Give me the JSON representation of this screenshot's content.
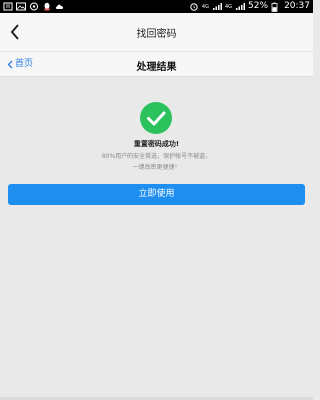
{
  "status_bar": {
    "net_label": "4G",
    "battery": "52%",
    "time": "20:37"
  },
  "header": {
    "title": "找回密码"
  },
  "subnav": {
    "home_label": "首页",
    "title": "处理结果"
  },
  "result": {
    "title": "重置密码成功!",
    "desc1": "80%用户的安全首选，保护帐号不被盗，",
    "desc2": "一键改密更便捷！",
    "button_label": "立即使用"
  },
  "colors": {
    "accent": "#1e8ef0",
    "success": "#2bc25e",
    "link": "#2b7de1"
  }
}
